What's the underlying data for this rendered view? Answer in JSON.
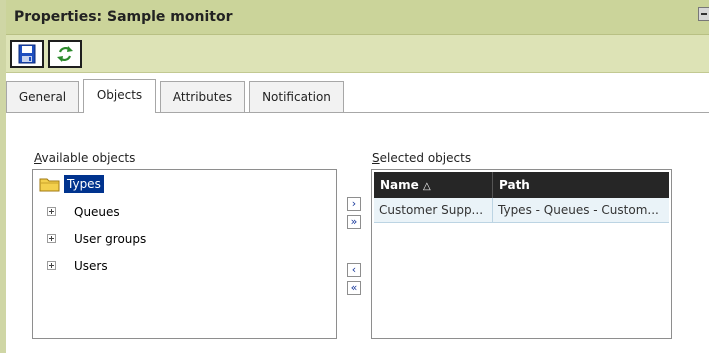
{
  "window": {
    "title": "Properties: Sample monitor"
  },
  "toolbar": {
    "buttons": [
      {
        "icon": "save-icon"
      },
      {
        "icon": "refresh-icon"
      }
    ]
  },
  "tabs": [
    {
      "label": "General",
      "active": false
    },
    {
      "label": "Objects",
      "active": true
    },
    {
      "label": "Attributes",
      "active": false
    },
    {
      "label": "Notification",
      "active": false
    }
  ],
  "available": {
    "label_accel": "A",
    "label_rest": "vailable objects",
    "root": {
      "label": "Types",
      "icon": "folder-icon",
      "selected": true
    },
    "items": [
      {
        "label": "Queues"
      },
      {
        "label": "User groups"
      },
      {
        "label": "Users"
      }
    ]
  },
  "transfer": {
    "add": "›",
    "add_all": "»",
    "remove": "‹",
    "remove_all": "«",
    "accent": "#1a3a9c"
  },
  "selected": {
    "label_accel": "S",
    "label_rest": "elected objects",
    "columns": [
      {
        "label": "Name",
        "sort": "△"
      },
      {
        "label": "Path"
      }
    ],
    "rows": [
      {
        "name": "Customer Supp...",
        "path": "Types - Queues - Custom..."
      }
    ]
  },
  "colors": {
    "titlebar": "#cbd49a",
    "toolbar": "#dde3b6",
    "selection": "#00338e",
    "grid_header": "#262626",
    "row": "#eaf3f8"
  }
}
